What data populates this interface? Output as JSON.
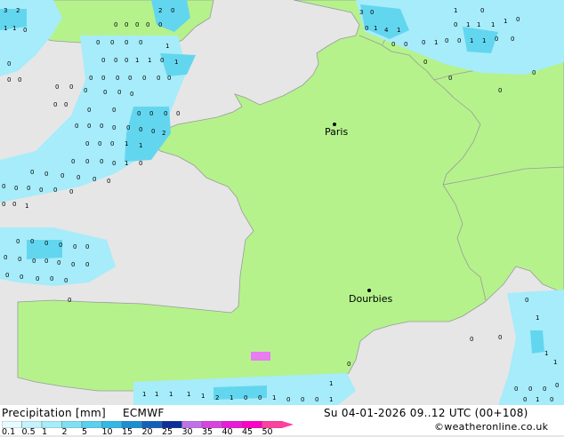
{
  "map": {
    "colors": {
      "sea": "#e6e6e6",
      "land": "#b5f28c",
      "border": "#9a9a9a",
      "precip_light": "#a6ecfa",
      "precip_mid": "#63d6ef",
      "precip_strong": "#2fb4e0",
      "precip_magenta": "#e87cf0"
    },
    "cities": [
      {
        "name": "Paris"
      },
      {
        "name": "Dourbies"
      }
    ]
  },
  "legend": {
    "title": "Precipitation [mm]",
    "model": "ECMWF",
    "valid_time": "Su 04-01-2026 09..12 UTC (00+108)",
    "credit": "©weatheronline.co.uk",
    "ticks": [
      "0.1",
      "0.5",
      "1",
      "2",
      "5",
      "10",
      "15",
      "20",
      "25",
      "30",
      "35",
      "40",
      "45",
      "50"
    ],
    "colors": [
      "#e6fbff",
      "#c4f3fd",
      "#a6ecfa",
      "#7fe0f5",
      "#5acfee",
      "#34b8e4",
      "#1a90d0",
      "#1460b8",
      "#0d2f9a",
      "#c070e8",
      "#d844e0",
      "#e81cd8",
      "#ff00c8",
      "#ff40a0"
    ]
  }
}
